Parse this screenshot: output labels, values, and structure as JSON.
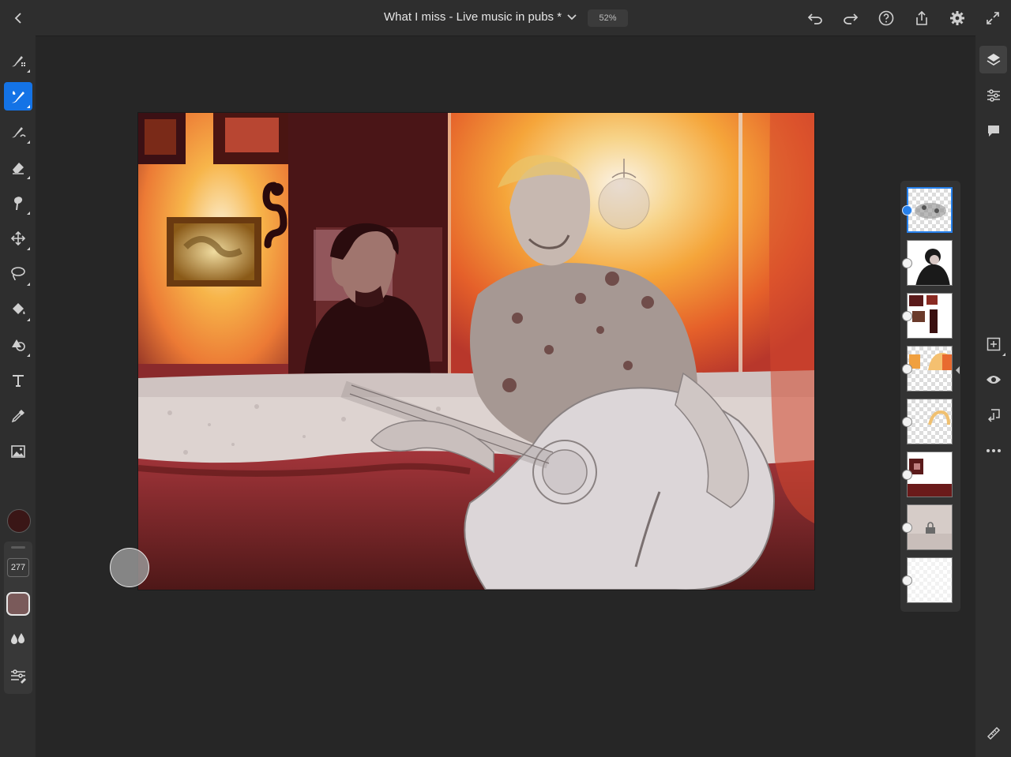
{
  "app": {
    "document_title": "What I miss - Live music in pubs *",
    "zoom": "52%"
  },
  "topbar": {
    "back_icon": "chevron-left-icon",
    "title_menu_icon": "chevron-down-icon",
    "actions": [
      "undo-icon",
      "redo-icon",
      "help-icon",
      "share-icon",
      "settings-icon",
      "fullscreen-icon"
    ]
  },
  "left_toolbar": {
    "tools": [
      "pixel-brush",
      "live-brush",
      "mixer-brush",
      "eraser",
      "smudge",
      "transform",
      "lasso-select",
      "fill",
      "shapes",
      "text",
      "eyedropper",
      "image-place"
    ],
    "active_tool": "live-brush",
    "color_swatch": "#3a1616",
    "brush_size": "277",
    "brush_opacity_color": "#7a5a5a"
  },
  "right_rail": {
    "buttons": [
      "layers-icon",
      "properties-icon",
      "comments-icon",
      "add-layer-icon",
      "visibility-icon",
      "layer-actions-icon",
      "more-icon",
      "ruler-icon"
    ]
  },
  "layers": {
    "count": 8,
    "selected_index": 0,
    "locked_index": 6
  },
  "colors": {
    "accent": "#2680eb",
    "background": "#262626",
    "panel": "#2e2e2e"
  }
}
